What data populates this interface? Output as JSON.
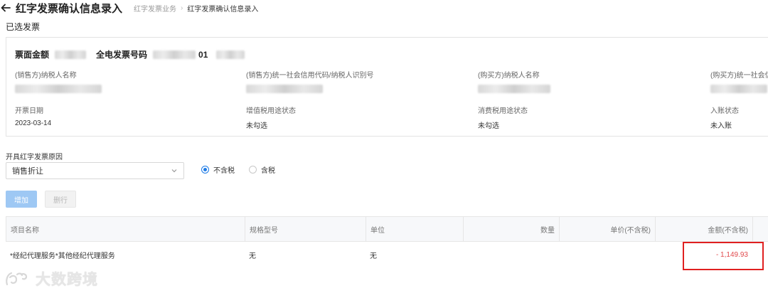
{
  "header": {
    "title": "红字发票确认信息录入",
    "breadcrumb": [
      "红字发票业务",
      "红字发票确认信息录入"
    ]
  },
  "selected_section_title": "已选发票",
  "invoice_card": {
    "amount_label": "票面金额",
    "number_label": "全电发票号码",
    "number_visible_fragment": "01",
    "fields": [
      {
        "label": "(销售方)纳税人名称",
        "value": ""
      },
      {
        "label": "(销售方)统一社会信用代码/纳税人识别号",
        "value": ""
      },
      {
        "label": "(购买方)纳税人名称",
        "value": ""
      },
      {
        "label": "(购买方)统一社会信",
        "value": ""
      },
      {
        "label": "开票日期",
        "value": "2023-03-14"
      },
      {
        "label": "增值税用途状态",
        "value": "未勾选"
      },
      {
        "label": "消费税用途状态",
        "value": "未勾选"
      },
      {
        "label": "入账状态",
        "value": "未入账"
      }
    ]
  },
  "reason": {
    "label": "开具红字发票原因",
    "selected": "销售折让"
  },
  "tax_mode": {
    "options": [
      "不含税",
      "含税"
    ],
    "selected": "不含税"
  },
  "actions": {
    "add_label": "增加",
    "delete_label": "删行"
  },
  "table": {
    "columns": [
      "项目名称",
      "规格型号",
      "单位",
      "数量",
      "单价(不含税)",
      "金额(不含税)"
    ],
    "rows": [
      [
        "*经纪代理服务*其他经纪代理服务",
        "无",
        "无",
        "",
        "",
        "- 1,149.93"
      ]
    ]
  },
  "watermark_text": "大数跨境",
  "colors": {
    "accent": "#1e7be6",
    "negative": "#e0484b",
    "highlight_border": "#e02020"
  }
}
